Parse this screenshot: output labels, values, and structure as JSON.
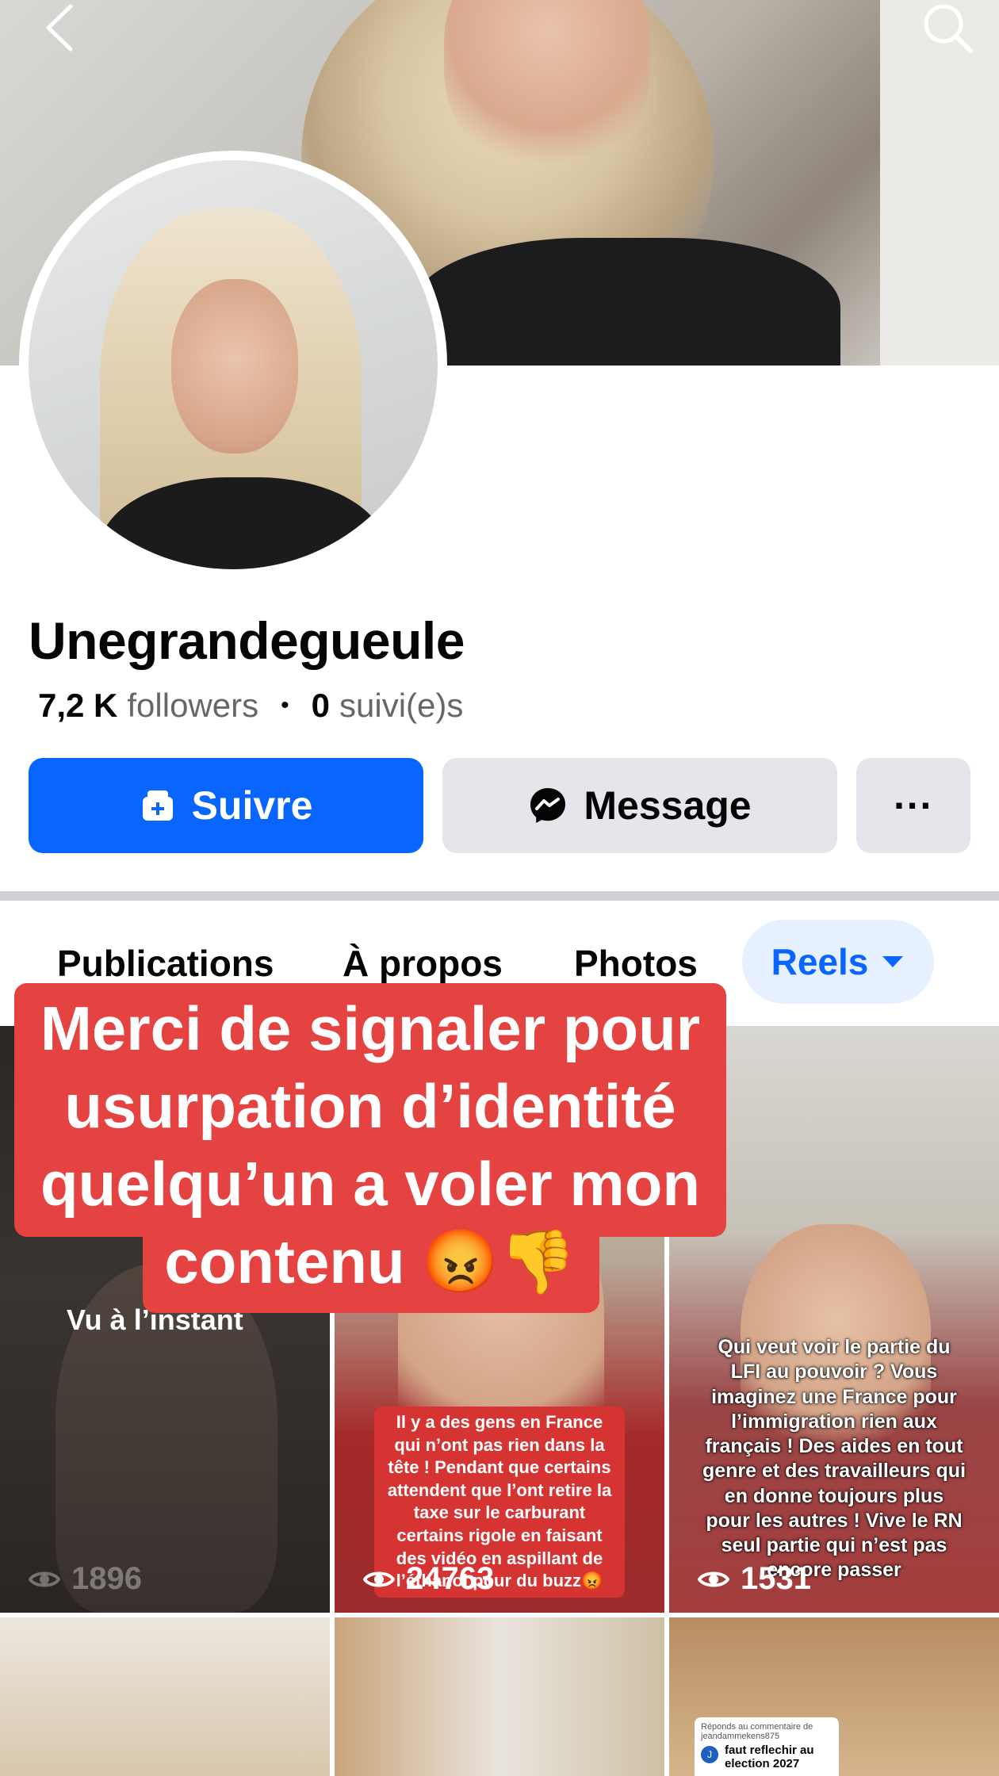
{
  "profile": {
    "name": "Unegrandegueule",
    "followers_count": "7,2 K",
    "followers_label": "followers",
    "following_count": "0",
    "following_label": "suivi(e)s"
  },
  "actions": {
    "follow_label": "Suivre",
    "message_label": "Message",
    "more_label": "···"
  },
  "tabs": [
    {
      "label": "Publications"
    },
    {
      "label": "À propos"
    },
    {
      "label": "Photos"
    },
    {
      "label": "Reels",
      "active": true
    }
  ],
  "reels": [
    {
      "views": "1896",
      "overlay_text": "Vu à l’instant"
    },
    {
      "views": "24763",
      "caption": "Il y a des gens en France qui n’ont pas rien dans la tête ! Pendant que certains attendent que l’ont retire la taxe sur le carburant certains rigole en faisant des vidéo en aspillant de l’éthanol pour du buzz😡"
    },
    {
      "views": "1531",
      "caption": "Qui veut voir le partie du LFI au pouvoir ? Vous imaginez une France pour l’immigration rien aux français ! Des aides en tout genre et des travailleurs qui en donne toujours plus pour les autres ! Vive le RN seul partie qui n’est pas encore passer"
    },
    {},
    {},
    {
      "reply_header": "Réponds au commentaire de jeandammekens875",
      "reply_initial": "J",
      "reply_text": "faut reflechir au election 2027"
    }
  ],
  "banner": {
    "text": "Merci de signaler pour usurpation d’identité quelqu’un a voler mon contenu 😡👎"
  },
  "colors": {
    "accent": "#0866ff",
    "banner": "#e54242",
    "secondary_button": "#e4e6eb",
    "active_tab_bg": "#e7f0fe"
  },
  "icons": [
    "back-icon",
    "search-icon",
    "follow-icon",
    "messenger-icon",
    "more-icon",
    "chevron-down-icon",
    "eye-icon"
  ]
}
